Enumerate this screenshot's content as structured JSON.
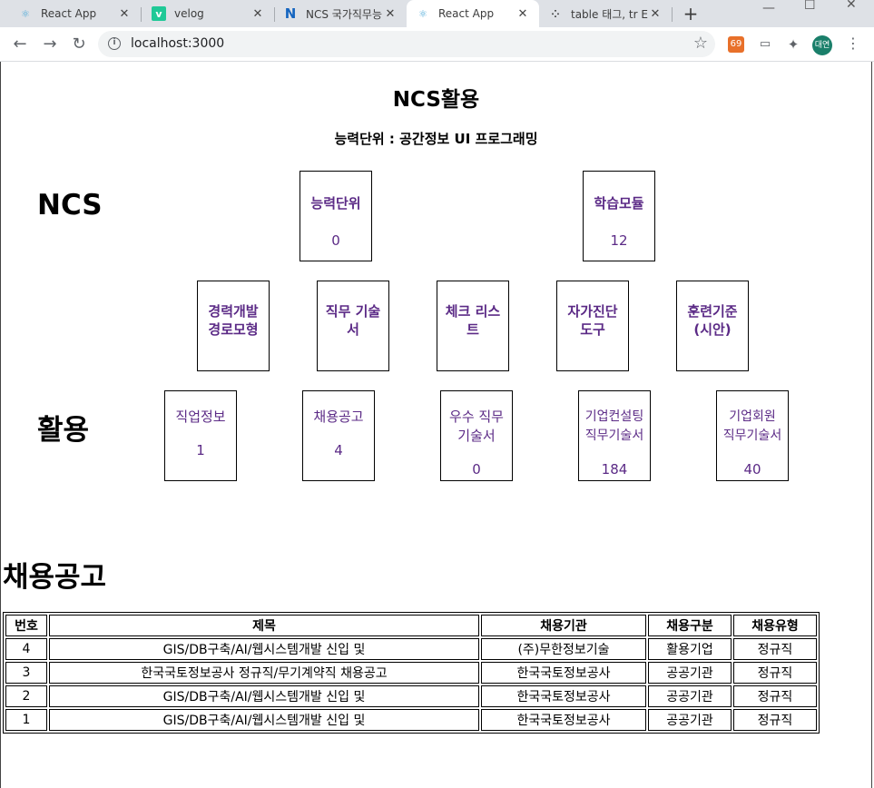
{
  "browser": {
    "tabs": [
      {
        "title": "React App",
        "icon": "react-icon",
        "active": false
      },
      {
        "title": "velog",
        "icon": "velog-icon",
        "active": false
      },
      {
        "title": "NCS 국가직무능",
        "icon": "ncs-icon",
        "active": false
      },
      {
        "title": "React App",
        "icon": "react-icon",
        "active": true
      },
      {
        "title": "table 태그, tr E",
        "icon": "dots-icon",
        "active": false
      }
    ],
    "url": "localhost:3000",
    "avatar_text": "대연",
    "extension_text": "69"
  },
  "page": {
    "title": "NCS활용",
    "subtitle": "능력단위 : 공간정보 UI 프로그래밍",
    "ncs_label": "NCS",
    "usage_label": "활용",
    "top_boxes": [
      {
        "label": "능력단위",
        "value": "0"
      },
      {
        "label": "학습모듈",
        "value": "12"
      }
    ],
    "mid_boxes": [
      {
        "label": "경력개발\n경로모형"
      },
      {
        "label": "직무 기술\n서"
      },
      {
        "label": "체크 리스\n트"
      },
      {
        "label": "자가진단\n도구"
      },
      {
        "label": "훈련기준\n(시안)"
      }
    ],
    "usage_boxes": [
      {
        "label": "직업정보",
        "value": "1"
      },
      {
        "label": "채용공고",
        "value": "4"
      },
      {
        "label": "우수 직무\n기술서",
        "value": "0"
      },
      {
        "label": "기업컨설팅\n직무기술서",
        "value": "184"
      },
      {
        "label": "기업회원\n직무기술서",
        "value": "40"
      }
    ]
  },
  "recruit": {
    "section_title": "채용공고",
    "headers": [
      "번호",
      "제목",
      "채용기관",
      "채용구분",
      "채용유형"
    ],
    "rows": [
      [
        "4",
        "GIS/DB구축/AI/웹시스템개발 신입 및",
        "(주)무한정보기술",
        "활용기업",
        "정규직"
      ],
      [
        "3",
        "한국국토정보공사 정규직/무기계약직 채용공고",
        "한국국토정보공사",
        "공공기관",
        "정규직"
      ],
      [
        "2",
        "GIS/DB구축/AI/웹시스템개발 신입 및",
        "한국국토정보공사",
        "공공기관",
        "정규직"
      ],
      [
        "1",
        "GIS/DB구축/AI/웹시스템개발 신입 및",
        "한국국토정보공사",
        "공공기관",
        "정규직"
      ]
    ]
  }
}
